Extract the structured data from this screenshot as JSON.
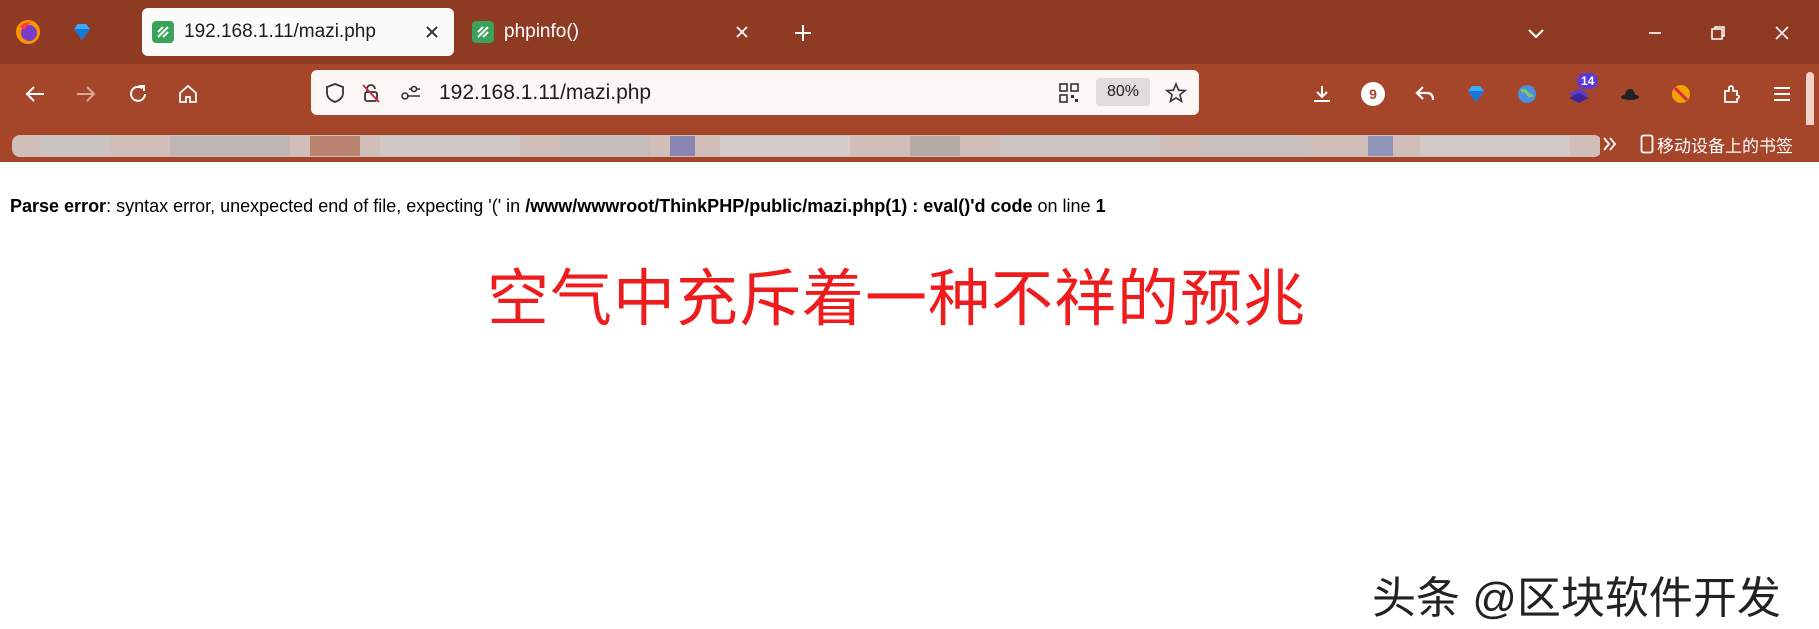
{
  "tabs": [
    {
      "label": "192.168.1.11/mazi.php",
      "active": true
    },
    {
      "label": "phpinfo()",
      "active": false
    }
  ],
  "address_bar": {
    "host": "192.168.1.11",
    "path": "/mazi.php",
    "zoom": "80%"
  },
  "toolbar": {
    "notification_badge": "9",
    "extension_badge": "14"
  },
  "bookmarks": {
    "mobile_bookmarks_label": "移动设备上的书签"
  },
  "page": {
    "error_label": "Parse error",
    "error_message": ": syntax error, unexpected end of file, expecting '(' in ",
    "error_path": "/www/wwwroot/ThinkPHP/public/mazi.php(1) : eval()'d code",
    "error_on_line": " on line ",
    "error_line": "1",
    "headline": "空气中充斥着一种不祥的预兆",
    "watermark": "头条 @区块软件开发"
  },
  "colors": {
    "tab_bar": "#8f3a22",
    "nav_bar": "#a5452a",
    "headline": "#ee1c1c",
    "badge": "#5b3bd6"
  }
}
